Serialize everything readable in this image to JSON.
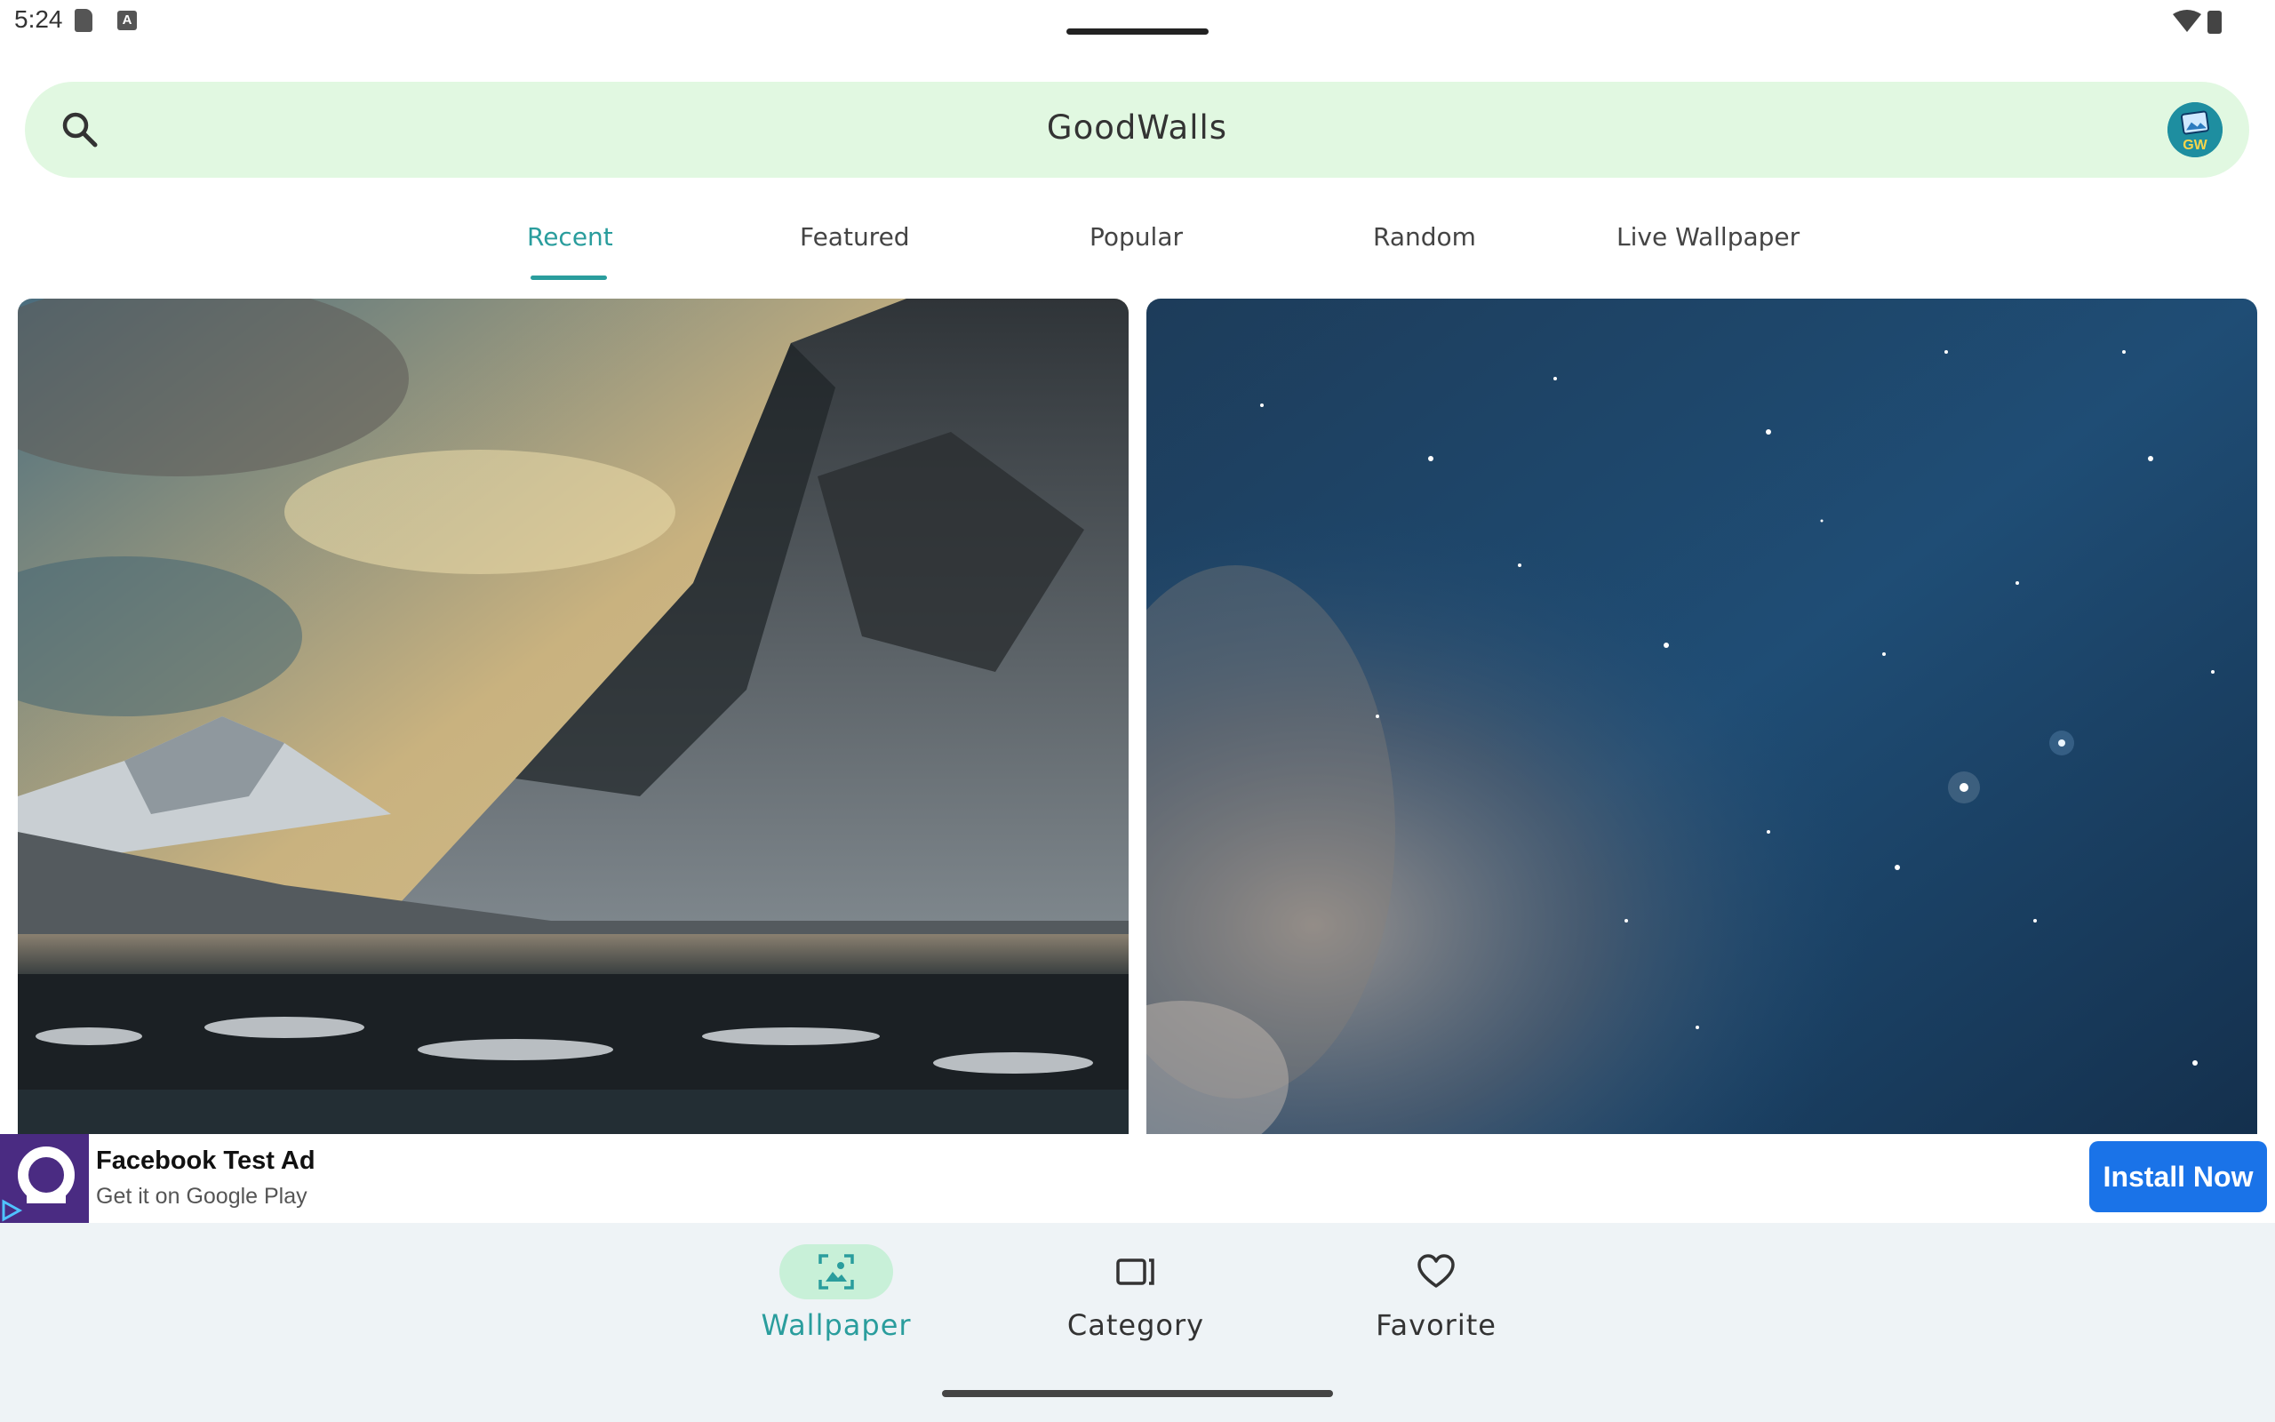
{
  "status_bar": {
    "time": "5:24"
  },
  "search_bar": {
    "title": "GoodWalls",
    "logo_text": "GW"
  },
  "tabs": [
    {
      "label": "Recent",
      "active": true
    },
    {
      "label": "Featured",
      "active": false
    },
    {
      "label": "Popular",
      "active": false
    },
    {
      "label": "Random",
      "active": false
    },
    {
      "label": "Live Wallpaper",
      "active": false
    }
  ],
  "wallpapers": [
    {
      "subject": "snowy-mountain-lake"
    },
    {
      "subject": "starry-night-sky"
    }
  ],
  "ad": {
    "title": "Facebook Test Ad",
    "subtitle": "Get it on Google Play",
    "button_label": "Install Now"
  },
  "bottom_nav": [
    {
      "label": "Wallpaper",
      "icon": "wallpaper-icon",
      "active": true
    },
    {
      "label": "Category",
      "icon": "category-icon",
      "active": false
    },
    {
      "label": "Favorite",
      "icon": "heart-icon",
      "active": false
    }
  ],
  "colors": {
    "accent": "#2a9d9d",
    "search_bg": "#e1f8e1",
    "nav_bg": "#eef3f6",
    "ad_button": "#1a73e8"
  }
}
